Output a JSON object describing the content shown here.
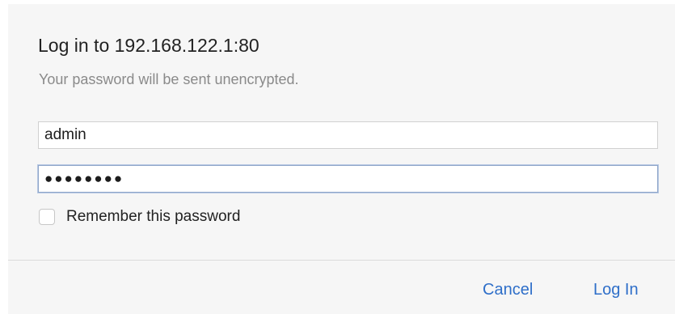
{
  "dialog": {
    "title": "Log in to 192.168.122.1:80",
    "subtitle": "Your password will be sent unencrypted.",
    "username_value": "admin",
    "password_value": "●●●●●●●●",
    "remember_label": "Remember this password",
    "remember_checked": false,
    "cancel_label": "Cancel",
    "login_label": "Log In",
    "accent_color": "#2f6fc9"
  }
}
